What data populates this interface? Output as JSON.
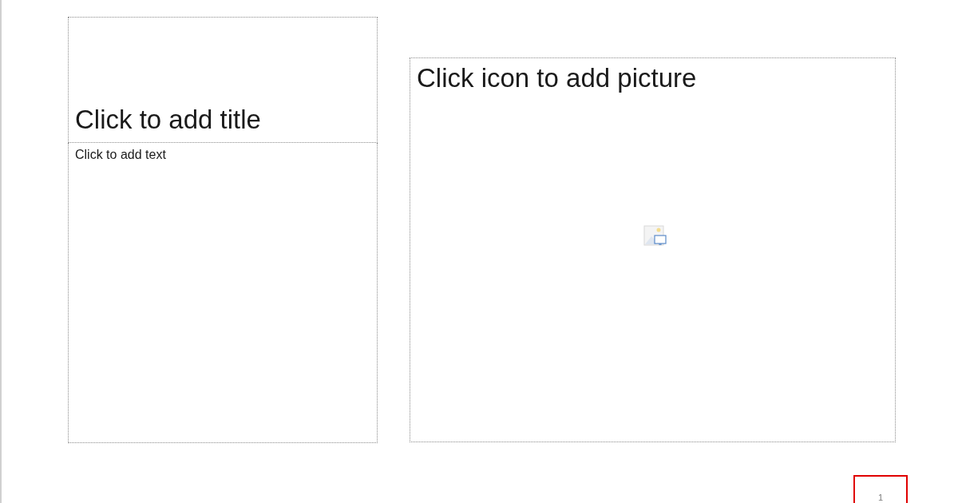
{
  "slide": {
    "title_placeholder": "Click to add title",
    "text_placeholder": "Click to add text",
    "picture_placeholder": "Click icon to add picture",
    "slide_number": "1"
  }
}
